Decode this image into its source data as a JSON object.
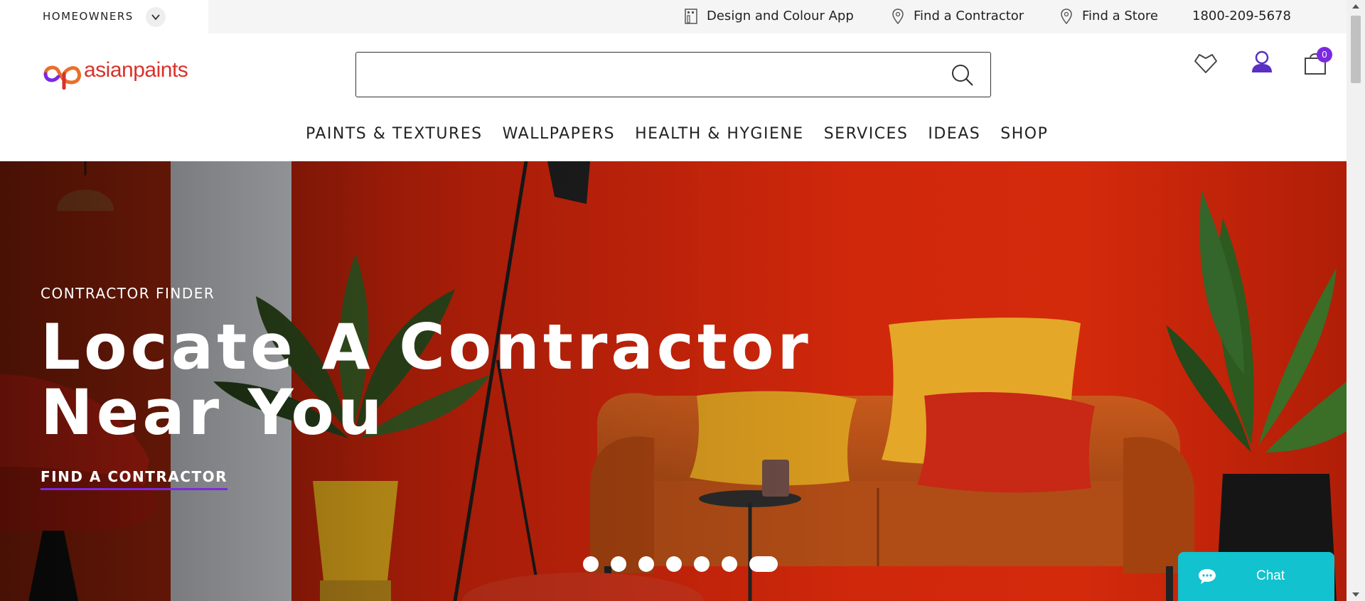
{
  "utility_bar": {
    "audience": "HOMEOWNERS",
    "links": {
      "design_app": "Design and Colour App",
      "find_contractor": "Find a Contractor",
      "find_store": "Find a Store",
      "phone": "1800-209-5678"
    }
  },
  "header": {
    "logo_text": "asianpaints",
    "search_placeholder": "",
    "cart_count": "0"
  },
  "nav": {
    "items": [
      "PAINTS & TEXTURES",
      "WALLPAPERS",
      "HEALTH & HYGIENE",
      "SERVICES",
      "IDEAS",
      "SHOP"
    ]
  },
  "hero": {
    "eyebrow": "CONTRACTOR FINDER",
    "title_line1": "Locate A Contractor",
    "title_line2": "Near You",
    "cta": "FIND A CONTRACTOR",
    "slide_count": 7,
    "active_slide": 7
  },
  "chat": {
    "label": "Chat"
  },
  "colors": {
    "brand_red": "#d9312b",
    "accent_purple": "#7b2ae0",
    "chat_teal": "#12c2ce",
    "hero_red": "#c41e08"
  },
  "icons": [
    "chevron-down-icon",
    "phone-app-icon",
    "location-pin-icon",
    "search-icon",
    "heart-icon",
    "user-icon",
    "cart-icon",
    "chat-bubble-icon"
  ]
}
